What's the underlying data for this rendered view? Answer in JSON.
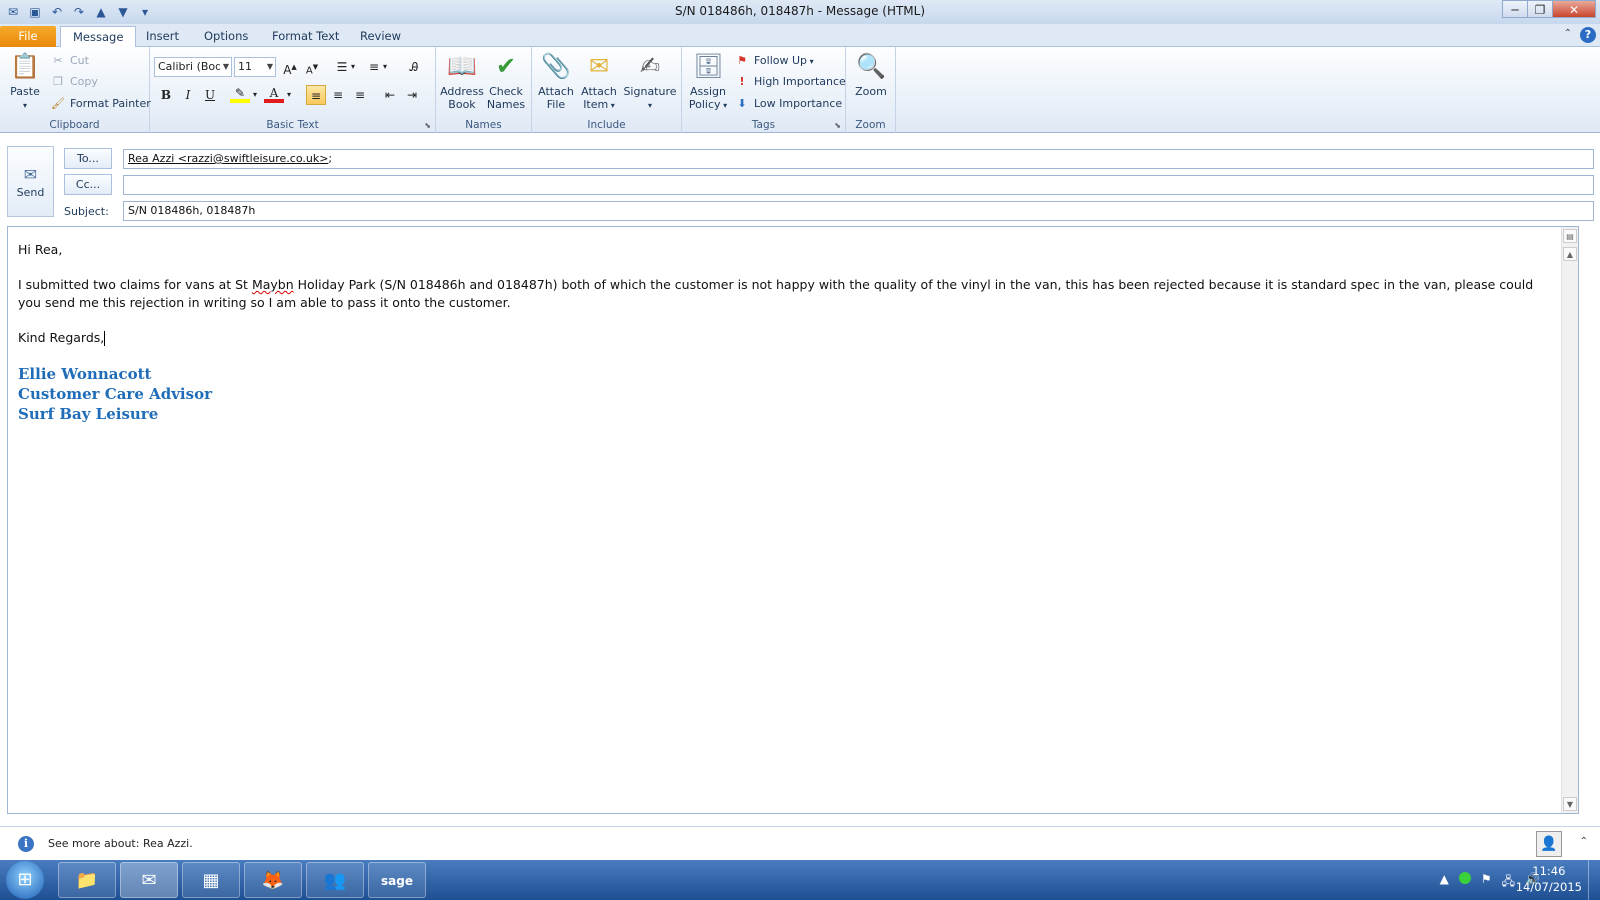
{
  "window": {
    "title": "S/N 018486h, 018487h  -  Message (HTML)"
  },
  "tabs": [
    {
      "label": "File"
    },
    {
      "label": "Message"
    },
    {
      "label": "Insert"
    },
    {
      "label": "Options"
    },
    {
      "label": "Format Text"
    },
    {
      "label": "Review"
    }
  ],
  "ribbon": {
    "clipboard": {
      "paste": "Paste",
      "cut": "Cut",
      "copy": "Copy",
      "format_painter": "Format Painter",
      "label": "Clipboard"
    },
    "basic_text": {
      "font": "Calibri (Body)",
      "size": "11",
      "bold": "B",
      "italic": "I",
      "underline": "U",
      "label": "Basic Text"
    },
    "names": {
      "address_book_1": "Address",
      "address_book_2": "Book",
      "check_names_1": "Check",
      "check_names_2": "Names",
      "label": "Names"
    },
    "include": {
      "attach_file_1": "Attach",
      "attach_file_2": "File",
      "attach_item_1": "Attach",
      "attach_item_2": "Item",
      "signature": "Signature",
      "label": "Include"
    },
    "tags": {
      "assign_policy_1": "Assign",
      "assign_policy_2": "Policy",
      "follow_up": "Follow Up",
      "high_importance": "High Importance",
      "low_importance": "Low Importance",
      "label": "Tags"
    },
    "zoom": {
      "zoom": "Zoom",
      "label": "Zoom"
    }
  },
  "header": {
    "send": "Send",
    "to_button": "To...",
    "cc_button": "Cc...",
    "subject_label": "Subject:",
    "to_value": "Rea Azzi <razzi@swiftleisure.co.uk>",
    "to_separator": ";",
    "cc_value": "",
    "subject_value": "S/N 018486h, 018487h"
  },
  "body": {
    "greeting": "Hi Rea,",
    "para_before": "I submitted two claims for vans at St ",
    "para_misspelled": "Maybn",
    "para_after": " Holiday Park (S/N 018486h and 018487h) both of which the customer is not happy with the quality of the vinyl in the van, this has been rejected because it is standard spec in the van, please could you send me this rejection in writing so I am able to pass it onto the customer.",
    "closing": "Kind Regards,",
    "signature_name": "Ellie Wonnacott",
    "signature_title": "Customer Care Advisor",
    "signature_company": "Surf Bay Leisure"
  },
  "people_pane": {
    "text": "See more about: Rea Azzi."
  },
  "taskbar": {
    "time": "11:46",
    "date": "14/07/2015",
    "apps": [
      "Windows Explorer",
      "Outlook",
      "Calendar",
      "Firefox",
      "Contacts",
      "Sage"
    ]
  },
  "colors": {
    "file_tab": "#e98a0b",
    "signature": "#1f6db8",
    "ribbon_bg": "#dfe9f5"
  }
}
